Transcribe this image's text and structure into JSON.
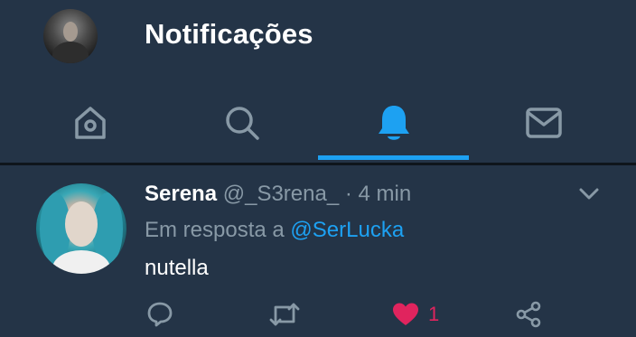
{
  "header": {
    "title": "Notificações",
    "avatar_icon": "user-avatar"
  },
  "tabs": [
    {
      "name": "home",
      "icon": "home-icon",
      "active": false
    },
    {
      "name": "search",
      "icon": "search-icon",
      "active": false
    },
    {
      "name": "notifications",
      "icon": "bell-icon",
      "active": true
    },
    {
      "name": "messages",
      "icon": "mail-icon",
      "active": false
    }
  ],
  "colors": {
    "accent": "#1da1f2",
    "background": "#243447",
    "muted": "#8899a6",
    "like": "#e0245e"
  },
  "notification": {
    "name": "Serena",
    "handle": "@_S3rena_",
    "separator": "·",
    "time": "4 min",
    "reply_prefix": "Em resposta a",
    "reply_to": "@SerLucka",
    "text": "nutella",
    "like_count": "1",
    "liked": true
  }
}
